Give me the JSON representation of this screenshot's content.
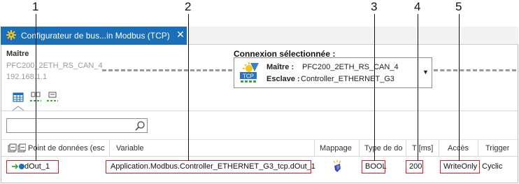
{
  "callouts": [
    "1",
    "2",
    "3",
    "4",
    "5"
  ],
  "tab": {
    "title": "Configurateur de bus...in Modbus (TCP)",
    "close": "✕",
    "icon": "bus-configurator-icon"
  },
  "master": {
    "label": "Maître",
    "name": "PFC200_2ETH_RS_CAN_4",
    "ip": "192.168.1.1"
  },
  "connection": {
    "label": "Connexion sélectionnée :",
    "master_key": "Maître :",
    "master_value": "PFC200_2ETH_RS_CAN_4",
    "slave_key": "Esclave :",
    "slave_value": "Controller_ETHERNET_G3",
    "icon_badge": "TCP",
    "dropdown": "▼"
  },
  "toolbar": {
    "views": [
      "table-view-icon",
      "network-view-icon",
      "device-view-icon"
    ]
  },
  "search": {
    "value": "",
    "placeholder": ""
  },
  "table": {
    "columns": [
      "Point de données (esc",
      "Variable",
      "Mappage",
      "Type de do",
      "T [ms]",
      "Accès",
      "Trigger"
    ],
    "rows": [
      {
        "datapoint": "dOut_1",
        "variable": "Application.Modbus.Controller_ETHERNET_G3_tcp.dOut_1",
        "mapping_icon": "mapping-icon",
        "type": "BOOL",
        "time": "200",
        "access": "WriteOnly",
        "trigger": "Cyclic"
      }
    ]
  },
  "colors": {
    "tab_active": "#1b6fb8",
    "highlight": "#e0161b",
    "dashed_link": "#9a9a9a",
    "mapping_yellow": "#f2b21a"
  }
}
